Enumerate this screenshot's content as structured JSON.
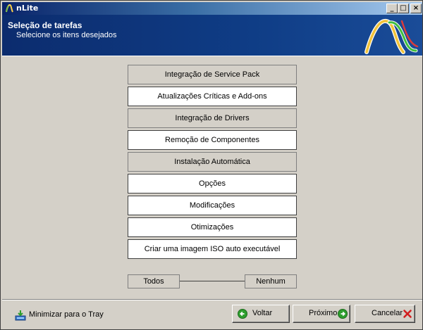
{
  "window": {
    "title": "nLite",
    "controls": {
      "minimize": "_",
      "maximize": "□",
      "close": "×"
    }
  },
  "header": {
    "title": "Seleção de tarefas",
    "subtitle": "Selecione os itens desejados"
  },
  "tasks": [
    {
      "label": "Integração de Service Pack",
      "selected": false
    },
    {
      "label": "Atualizações Críticas e Add-ons",
      "selected": true
    },
    {
      "label": "Integração de Drivers",
      "selected": false
    },
    {
      "label": "Remoção de Componentes",
      "selected": true
    },
    {
      "label": "Instalação Automática",
      "selected": false
    },
    {
      "label": "Opções",
      "selected": true
    },
    {
      "label": "Modificações",
      "selected": true
    },
    {
      "label": "Otimizações",
      "selected": true
    },
    {
      "label": "Criar uma imagem ISO auto executável",
      "selected": true
    }
  ],
  "selection": {
    "all_label": "Todos",
    "none_label": "Nenhum"
  },
  "footer": {
    "tray_label": "Minimizar para o Tray",
    "back_label": "Voltar",
    "next_label": "Próximo",
    "cancel_label": "Cancelar"
  },
  "colors": {
    "header_bg": "#0f3d86",
    "task_selected_bg": "#ffffff",
    "task_unselected_bg": "#d4d0c8",
    "back_icon": "#2e9e2e",
    "next_icon": "#2e9e2e",
    "cancel_icon": "#d21f1f"
  },
  "icons": {
    "app": "nlite-logo-icon",
    "tray": "tray-download-icon",
    "back": "arrow-left-circle-icon",
    "next": "arrow-right-circle-icon",
    "cancel": "red-x-icon"
  }
}
